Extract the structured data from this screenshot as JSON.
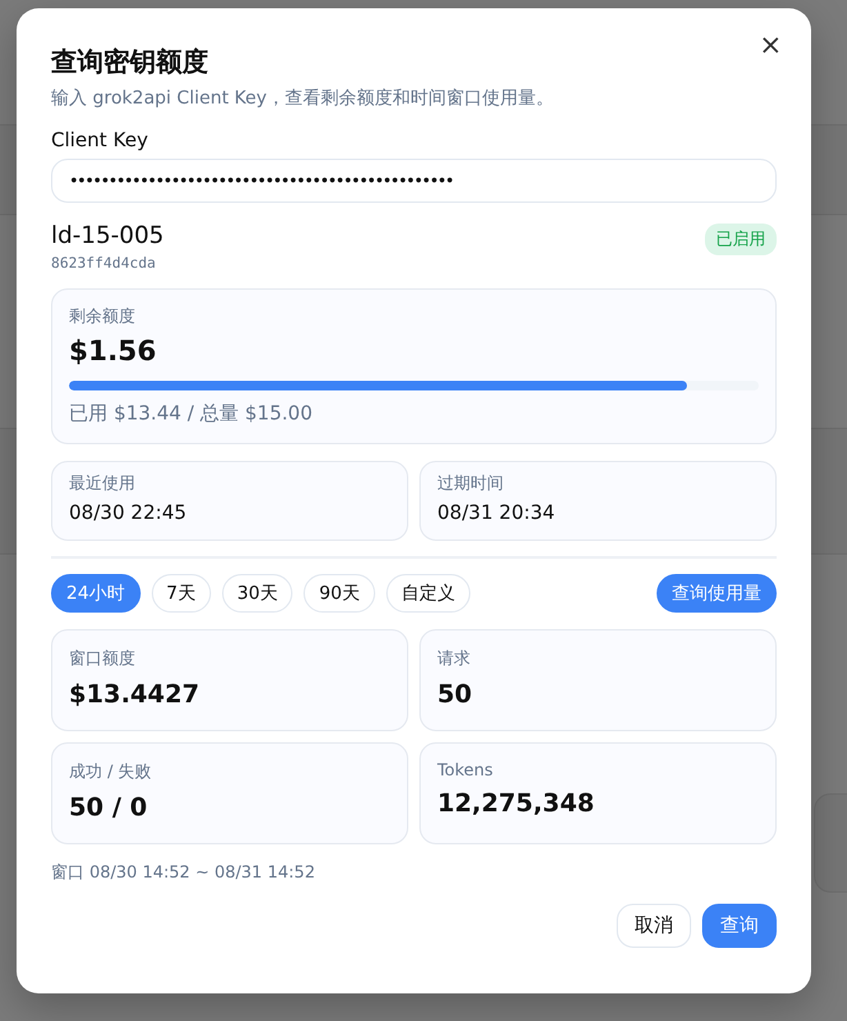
{
  "dialog": {
    "title": "查询密钥额度",
    "subtitle": "输入 grok2api Client Key，查看剩余额度和时间窗口使用量。",
    "close": "×"
  },
  "key_field": {
    "label": "Client Key",
    "value": "•••••••••••••••••••••••••••••••••••••••••••••••••"
  },
  "key_info": {
    "name": "ld-15-005",
    "id": "8623ff4d4cda",
    "status": "已启用",
    "enabled": true
  },
  "balance": {
    "label": "剩余额度",
    "value": "$1.56",
    "level": 0.896,
    "detail": "已用 $13.44 / 总量 $15.00"
  },
  "times": [
    {
      "label": "最近使用",
      "value": "08/30 22:45"
    },
    {
      "label": "过期时间",
      "value": "08/31 20:34"
    }
  ],
  "ranges": [
    {
      "label": "24小时",
      "selected": true
    },
    {
      "label": "7天",
      "selected": false
    },
    {
      "label": "30天",
      "selected": false
    },
    {
      "label": "90天",
      "selected": false
    },
    {
      "label": "自定义",
      "selected": false
    }
  ],
  "query_usage_button": "查询使用量",
  "stats": [
    {
      "label": "窗口额度",
      "value": "$13.4427"
    },
    {
      "label": "请求",
      "value": "50"
    },
    {
      "label": "成功 / 失败",
      "value": "50 / 0"
    },
    {
      "label": "Tokens",
      "value": "12,275,348"
    }
  ],
  "window_note": "窗口 08/30 14:52 ~ 08/31 14:52",
  "buttons": [
    {
      "label": "取消",
      "kind": "secondary"
    },
    {
      "label": "查询",
      "kind": "primary"
    }
  ]
}
